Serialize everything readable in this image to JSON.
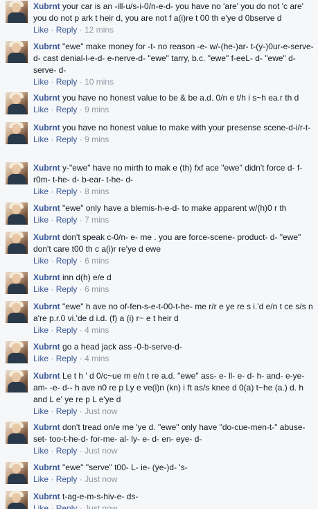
{
  "thread": {
    "like_label": "Like",
    "reply_label": "Reply",
    "separator": "·",
    "comments": [
      {
        "author": "Xubrnt",
        "text": "your car is an -ill-u/s-i-0/n-e-d- you have no 'are' you do not 'c are' you do not p ark t heir d, you are not f a(i)re t 00 th e'ye d 0bserve d",
        "time": "12 mins"
      },
      {
        "author": "Xubrnt",
        "text": "\"ewe\" make money for -t- no reason -e- w/-(he-)ar- t-(y-)0ur-e-serve- d- cast denial-l-e-d- e-nerve-d- \"ewe\" tarry, b.c. \"ewe\" f-eeL- d- \"ewe\" d- serve- d-",
        "time": "10 mins"
      },
      {
        "author": "Xubrnt",
        "text": "you have no honest value to be & be a.d. 0/n e t/h i s~h ea.r th d",
        "time": "9 mins"
      },
      {
        "author": "Xubrnt",
        "text": "you have no honest value to make with your presense scene-d-i/r-t-",
        "time": "9 mins"
      },
      {
        "author": "Xubrnt",
        "text": "y-\"ewe\" have no mirth to mak e (th) fxf ace \"ewe\" didn't force d- f-r0m- t-he- d- b-ear- t-he- d-",
        "time": "8 mins"
      },
      {
        "author": "Xubrnt",
        "text": "\"ewe\" only have a blemis-h-e-d- to make apparent w/(h)0 r th",
        "time": "7 mins"
      },
      {
        "author": "Xubrnt",
        "text": "don't speak c-0/n- e- me . you are force-scene- product- d- \"ewe\" don't care t00 th c a(i)r re'ye d ewe",
        "time": "6 mins"
      },
      {
        "author": "Xubrnt",
        "text": "inn d(h) e/e d",
        "time": "6 mins"
      },
      {
        "author": "Xubrnt",
        "text": "\"ewe\" h ave no of-fen-s-e-t-00-t-he- me r/r e ye re s i.'d e/n t ce s/s n a're p.r.0 vi.'de d i.d. (f) a (i) r~ e t heir d",
        "time": "4 mins"
      },
      {
        "author": "Xubrnt",
        "text": "go a head jack ass -0-b-serve-d-",
        "time": "4 mins"
      },
      {
        "author": "Xubrnt",
        "text": "Le t h ' d 0/c~ue m e/n t re a.d. \"ewe\" ass- e- ll- e- d- h- and- e-ye-am- -e- d-- h ave n0 re p Ly e ve(i)n (kn) i ft as/s knee d 0(a) t~he (a.) d. h and L e' ye re p L e'ye d",
        "time": "Just now"
      },
      {
        "author": "Xubrnt",
        "text": "don't tread on/e me 'ye d. \"ewe\" only have \"do-cue-men-t-\" abuse-set- too-t-he-d- for-me- al- ly- e- d- en- eye- d-",
        "time": "Just now"
      },
      {
        "author": "Xubrnt",
        "text": "\"ewe\" \"serve\" t00- L- ie- (ye-)d- 's-",
        "time": "Just now"
      },
      {
        "author": "Xubrnt",
        "text": "t-ag-e-m-s-hiv-e- ds-",
        "time": "Just now"
      }
    ]
  }
}
